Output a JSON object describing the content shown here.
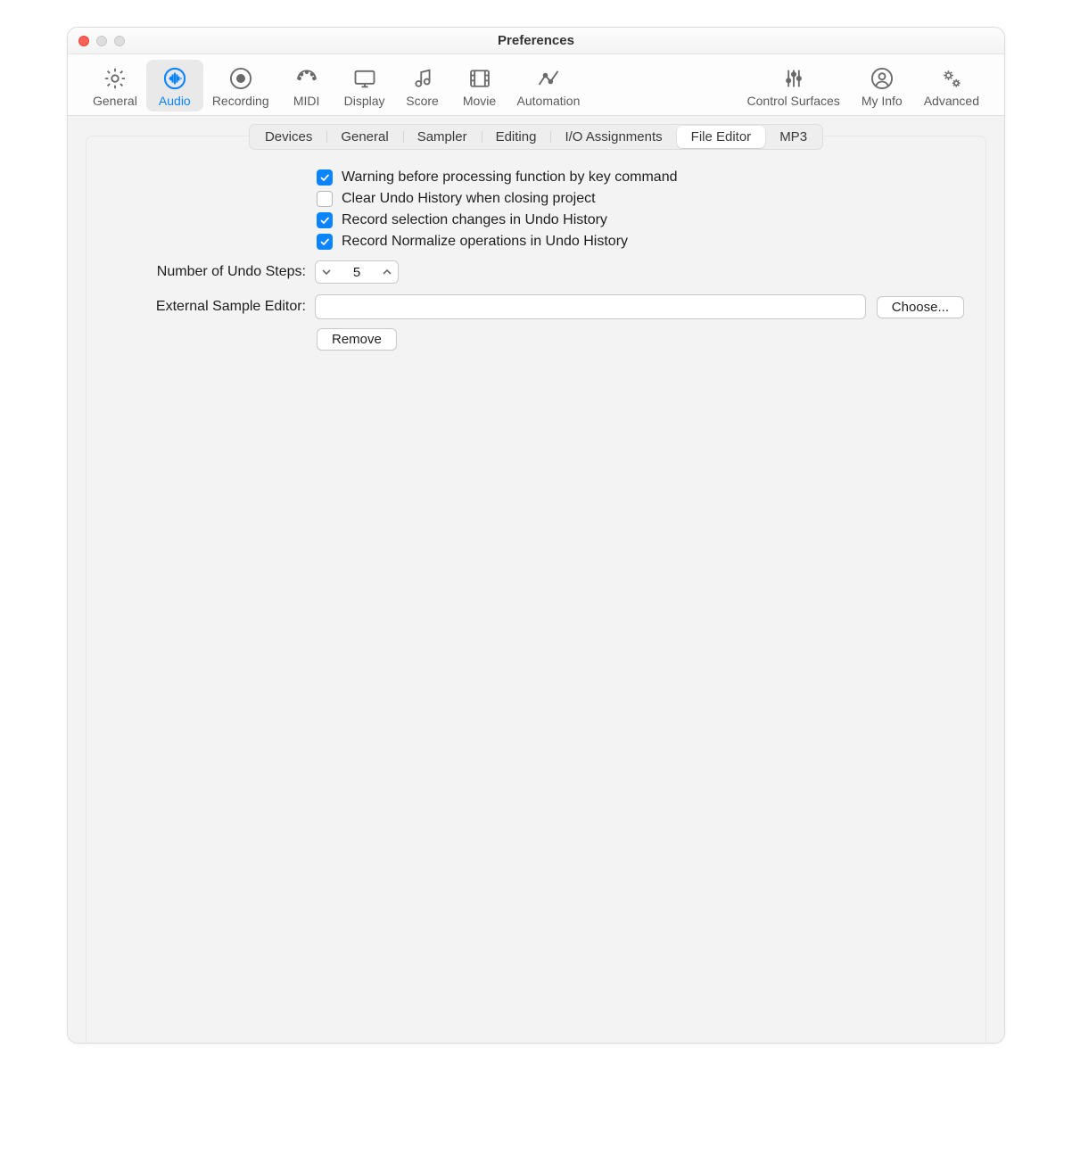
{
  "window": {
    "title": "Preferences"
  },
  "toolbar": [
    {
      "id": "general",
      "label": "General"
    },
    {
      "id": "audio",
      "label": "Audio",
      "selected": true
    },
    {
      "id": "recording",
      "label": "Recording"
    },
    {
      "id": "midi",
      "label": "MIDI"
    },
    {
      "id": "display",
      "label": "Display"
    },
    {
      "id": "score",
      "label": "Score"
    },
    {
      "id": "movie",
      "label": "Movie"
    },
    {
      "id": "automation",
      "label": "Automation"
    },
    {
      "id": "surfaces",
      "label": "Control Surfaces"
    },
    {
      "id": "myinfo",
      "label": "My Info"
    },
    {
      "id": "advanced",
      "label": "Advanced"
    }
  ],
  "subtabs": {
    "items": [
      "Devices",
      "General",
      "Sampler",
      "Editing",
      "I/O Assignments",
      "File Editor",
      "MP3"
    ],
    "active": "File Editor"
  },
  "checks": [
    {
      "label": "Warning before processing function by key command",
      "checked": true
    },
    {
      "label": "Clear Undo History when closing project",
      "checked": false
    },
    {
      "label": "Record selection changes in Undo History",
      "checked": true
    },
    {
      "label": "Record Normalize operations in Undo History",
      "checked": true
    }
  ],
  "undo": {
    "label": "Number of Undo Steps:",
    "value": "5"
  },
  "editor": {
    "label": "External Sample Editor:",
    "path": "",
    "choose": "Choose...",
    "remove": "Remove"
  }
}
